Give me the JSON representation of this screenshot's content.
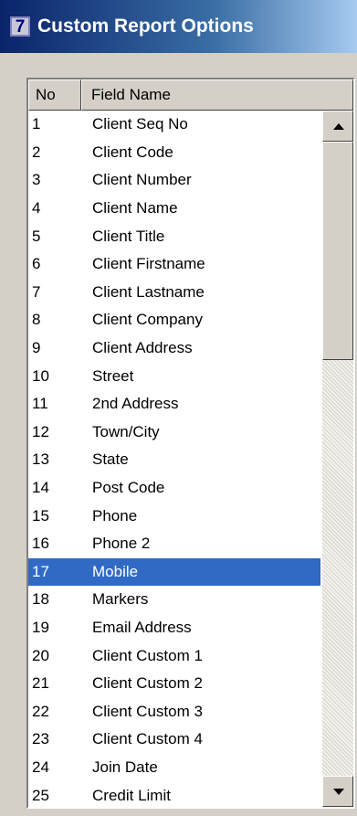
{
  "window": {
    "icon": "7",
    "title": "Custom Report Options"
  },
  "list": {
    "columns": {
      "no": "No",
      "field_name": "Field Name"
    },
    "rows": [
      {
        "no": "1",
        "name": "Client Seq No"
      },
      {
        "no": "2",
        "name": "Client Code"
      },
      {
        "no": "3",
        "name": "Client Number"
      },
      {
        "no": "4",
        "name": "Client Name"
      },
      {
        "no": "5",
        "name": "Client Title"
      },
      {
        "no": "6",
        "name": "Client Firstname"
      },
      {
        "no": "7",
        "name": "Client Lastname"
      },
      {
        "no": "8",
        "name": "Client Company"
      },
      {
        "no": "9",
        "name": "Client Address"
      },
      {
        "no": "10",
        "name": "Street"
      },
      {
        "no": "11",
        "name": "2nd Address"
      },
      {
        "no": "12",
        "name": "Town/City"
      },
      {
        "no": "13",
        "name": "State"
      },
      {
        "no": "14",
        "name": "Post Code"
      },
      {
        "no": "15",
        "name": "Phone"
      },
      {
        "no": "16",
        "name": "Phone 2"
      },
      {
        "no": "17",
        "name": "Mobile"
      },
      {
        "no": "18",
        "name": "Markers"
      },
      {
        "no": "19",
        "name": "Email Address"
      },
      {
        "no": "20",
        "name": "Client Custom 1"
      },
      {
        "no": "21",
        "name": "Client Custom 2"
      },
      {
        "no": "22",
        "name": "Client Custom 3"
      },
      {
        "no": "23",
        "name": "Client Custom 4"
      },
      {
        "no": "24",
        "name": "Join Date"
      },
      {
        "no": "25",
        "name": "Credit Limit"
      }
    ],
    "selected_row": 17
  },
  "colors": {
    "selection": "#316ac5",
    "title_bar": "#0a246a"
  },
  "icons": {
    "scroll_up": "arrow-up-icon",
    "scroll_down": "arrow-down-icon",
    "window": "app-icon"
  }
}
